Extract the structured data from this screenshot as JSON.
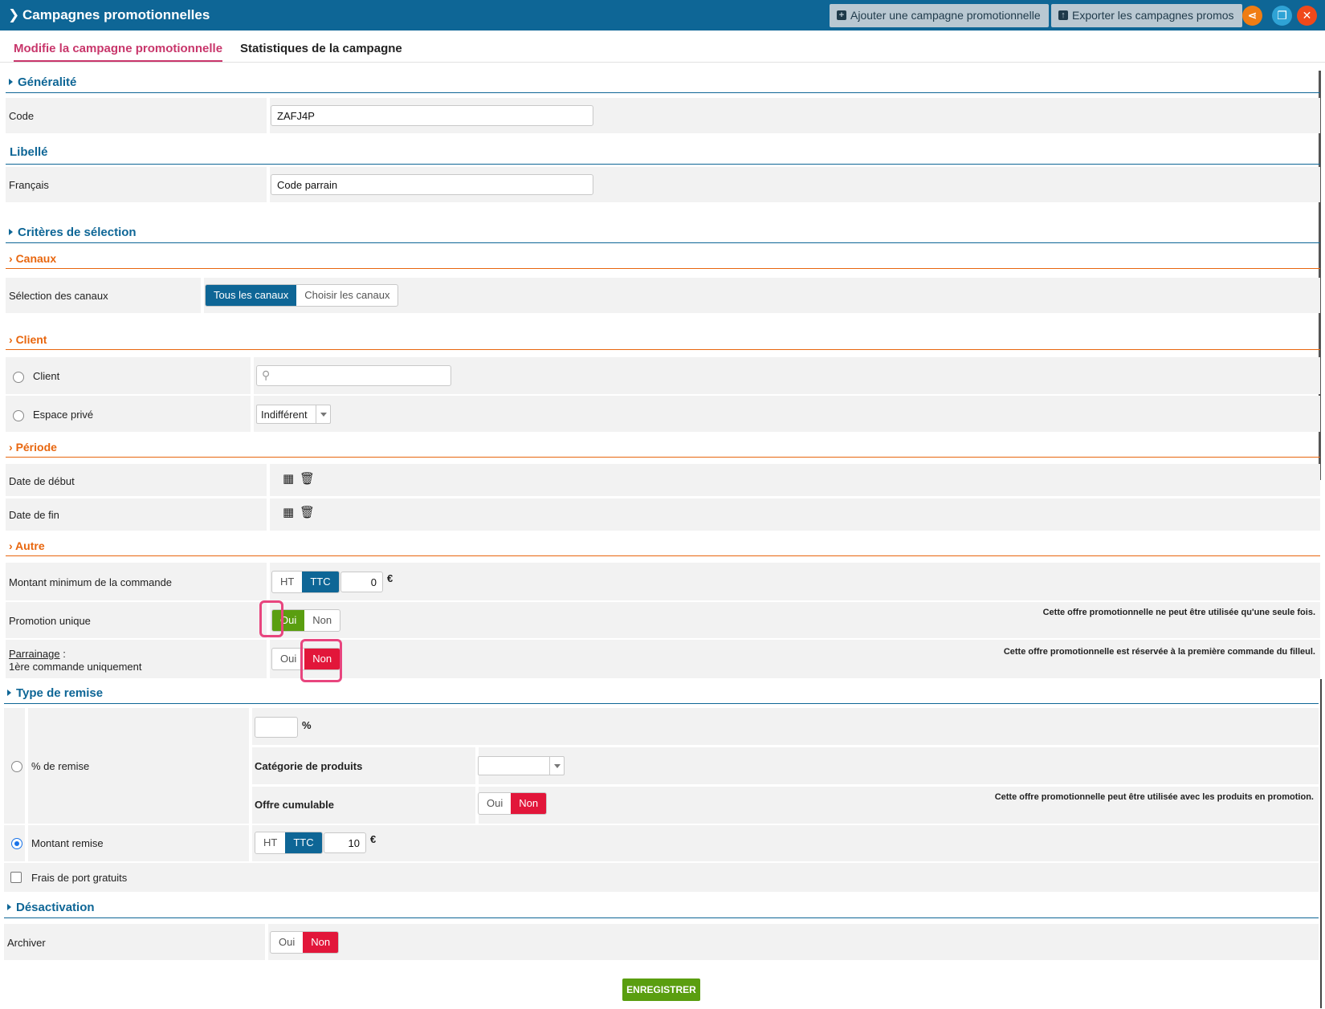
{
  "window": {
    "title": "Campagnes promotionnelles",
    "add_button": "Ajouter une campagne promotionnelle",
    "export_button": "Exporter les campagnes promos",
    "colors": {
      "titlebar": "#0e6696",
      "share": "#f07d13",
      "copy": "#2fa3d5",
      "close": "#f0491b"
    }
  },
  "tabs": [
    {
      "label": "Modifie la campagne promotionnelle",
      "active": true
    },
    {
      "label": "Statistiques de la campagne",
      "active": false
    }
  ],
  "general": {
    "heading": "Généralité",
    "code_label": "Code",
    "code_value": "ZAFJ4P",
    "libelle_heading": "Libellé",
    "francais_label": "Français",
    "francais_value": "Code parrain"
  },
  "criteria": {
    "heading": "Critères de sélection",
    "canaux": {
      "heading": "Canaux",
      "selection_label": "Sélection des canaux",
      "option_all": "Tous les canaux",
      "option_choose": "Choisir les canaux"
    },
    "client": {
      "heading": "Client",
      "client_label": "Client",
      "espace_label": "Espace privé",
      "espace_value": "Indifférent"
    },
    "periode": {
      "heading": "Période",
      "start_label": "Date de début",
      "end_label": "Date de fin"
    },
    "autre": {
      "heading": "Autre",
      "min_amount_label": "Montant minimum de la commande",
      "ht": "HT",
      "ttc": "TTC",
      "min_amount_value": "0",
      "currency": "€",
      "promo_unique_label": "Promotion unique",
      "oui": "Oui",
      "non": "Non",
      "promo_unique_note": "Cette offre promotionnelle ne peut être utilisée qu'une seule fois.",
      "parrainage_label": "Parrainage",
      "parrainage_colon": " :",
      "parrainage_sub": "1ère commande uniquement",
      "parrainage_note": "Cette offre promotionnelle est réservée à la première commande du filleul."
    }
  },
  "remise": {
    "heading": "Type de remise",
    "percent_label": "% de remise",
    "percent_symbol": "%",
    "categorie_label": "Catégorie de produits",
    "cumulable_label": "Offre cumulable",
    "cumulable_note": "Cette offre promotionnelle peut être utilisée avec les produits en promotion.",
    "montant_label": "Montant remise",
    "montant_value": "10",
    "frais_label": "Frais de port gratuits"
  },
  "desactivation": {
    "heading": "Désactivation",
    "archiver_label": "Archiver"
  },
  "save_button": "ENREGISTRER"
}
